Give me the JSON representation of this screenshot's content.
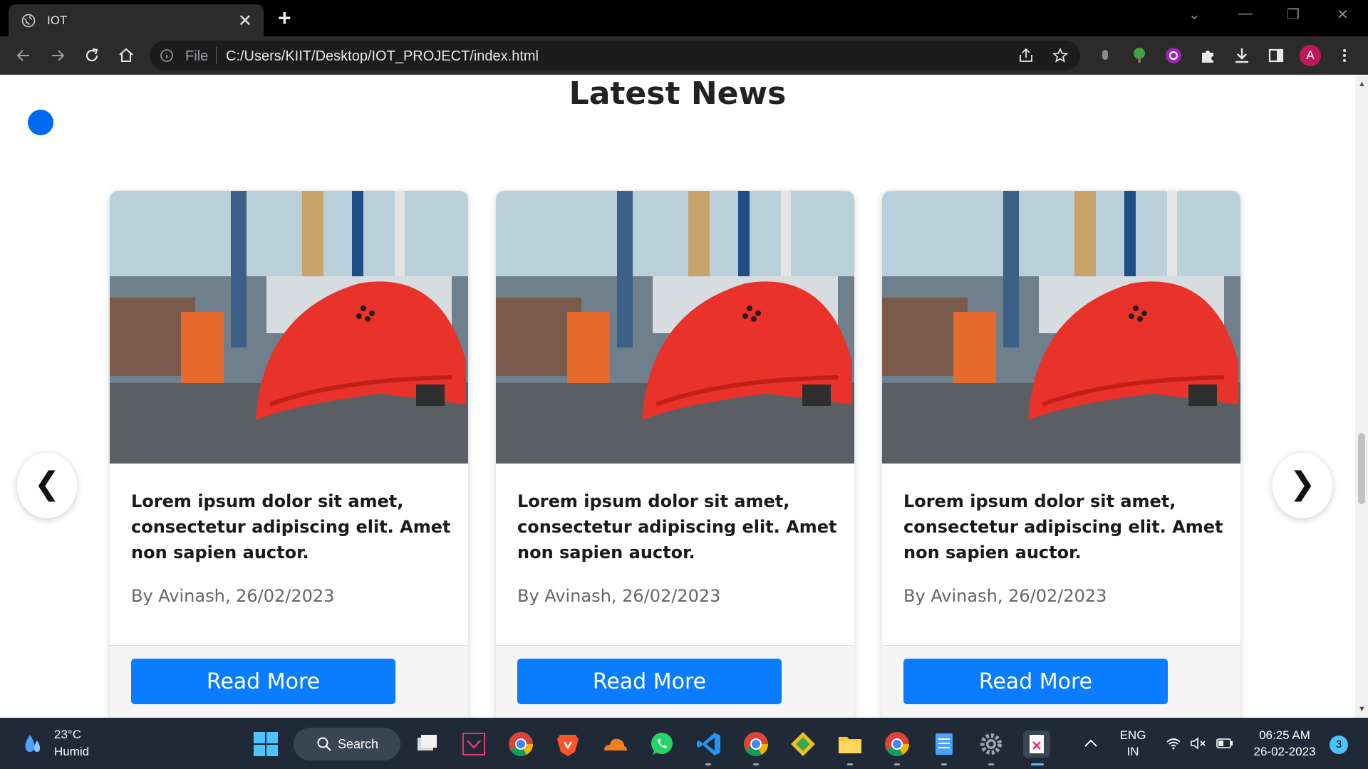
{
  "browser": {
    "tab_title": "IOT",
    "address_prefix": "File",
    "address_url": "C:/Users/KIIT/Desktop/IOT_PROJECT/index.html",
    "profile_initial": "A"
  },
  "page": {
    "section_title": "Latest News",
    "cards": [
      {
        "title": "Lorem ipsum dolor sit amet, consectetur adipiscing elit. Amet non sapien auctor.",
        "meta": "By Avinash, 26/02/2023",
        "button": "Read More"
      },
      {
        "title": "Lorem ipsum dolor sit amet, consectetur adipiscing elit. Amet non sapien auctor.",
        "meta": "By Avinash, 26/02/2023",
        "button": "Read More"
      },
      {
        "title": "Lorem ipsum dolor sit amet, consectetur adipiscing elit. Amet non sapien auctor.",
        "meta": "By Avinash, 26/02/2023",
        "button": "Read More"
      }
    ],
    "prev_arrow": "❮",
    "next_arrow": "❯"
  },
  "taskbar": {
    "weather_temp": "23°C",
    "weather_desc": "Humid",
    "search_label": "Search",
    "language_top": "ENG",
    "language_bottom": "IN",
    "time": "06:25 AM",
    "date": "26-02-2023",
    "notification_count": "3"
  },
  "colors": {
    "accent": "#0a7cff",
    "dot": "#0069f3",
    "helmet": "#e8322a"
  }
}
